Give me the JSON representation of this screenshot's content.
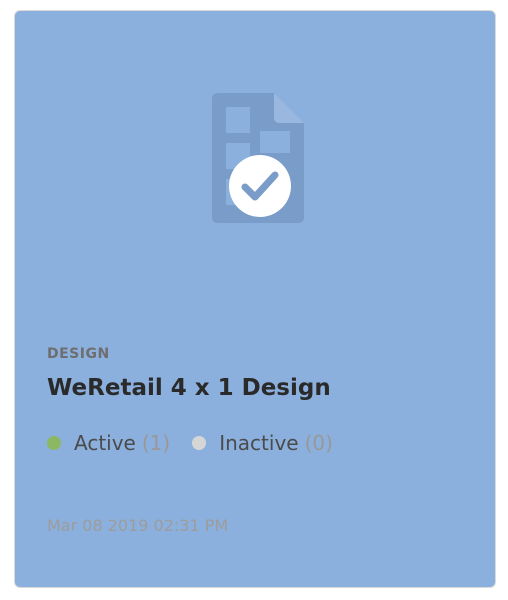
{
  "card": {
    "type_label": "DESIGN",
    "title": "WeRetail 4 x 1 Design",
    "thumbnail_icon": "design-document-icon",
    "badge_icon": "checkmark-icon",
    "background_color": "#8bb0dd",
    "statuses": [
      {
        "label": "Active",
        "count": "(1)",
        "dot_color": "#8cb864"
      },
      {
        "label": "Inactive",
        "count": "(0)",
        "dot_color": "#d6d6d6"
      }
    ],
    "timestamp": "Mar 08 2019 02:31 PM"
  }
}
